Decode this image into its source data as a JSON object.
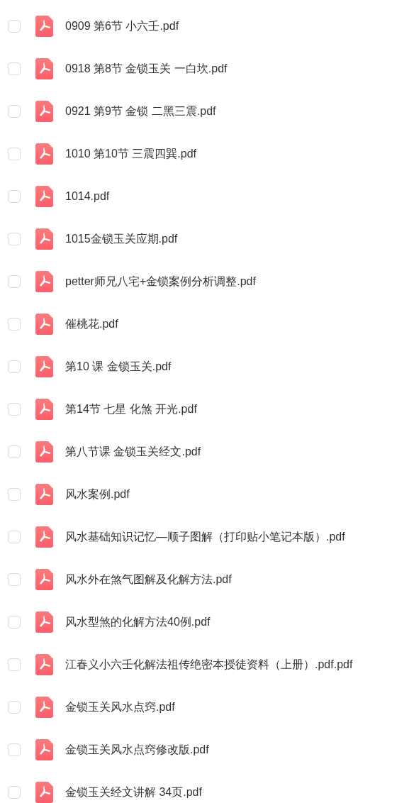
{
  "files": [
    {
      "name": "0909 第6节 小六壬.pdf",
      "checked": false
    },
    {
      "name": "0918 第8节 金锁玉关 一白坎.pdf",
      "checked": false
    },
    {
      "name": "0921 第9节 金锁 二黑三震.pdf",
      "checked": false
    },
    {
      "name": "1010 第10节 三震四巽.pdf",
      "checked": false
    },
    {
      "name": "1014.pdf",
      "checked": false
    },
    {
      "name": "1015金锁玉关应期.pdf",
      "checked": false
    },
    {
      "name": "petter师兄八宅+金锁案例分析调整.pdf",
      "checked": false
    },
    {
      "name": "催桃花.pdf",
      "checked": false
    },
    {
      "name": "第10 课 金锁玉关.pdf",
      "checked": false
    },
    {
      "name": "第14节 七星 化煞 开光.pdf",
      "checked": false
    },
    {
      "name": "第八节课 金锁玉关经文.pdf",
      "checked": false
    },
    {
      "name": "风水案例.pdf",
      "checked": false
    },
    {
      "name": "风水基础知识记忆—顺子图解（打印贴小笔记本版）.pdf",
      "checked": false
    },
    {
      "name": "风水外在煞气图解及化解方法.pdf",
      "checked": false
    },
    {
      "name": "风水型煞的化解方法40例.pdf",
      "checked": false
    },
    {
      "name": "江春义小六壬化解法祖传绝密本授徒资料（上册）.pdf.pdf",
      "checked": false
    },
    {
      "name": "金锁玉关风水点窍.pdf",
      "checked": false
    },
    {
      "name": "金锁玉关风水点窍修改版.pdf",
      "checked": false
    },
    {
      "name": "金锁玉关经文讲解 34页.pdf",
      "checked": false
    }
  ]
}
